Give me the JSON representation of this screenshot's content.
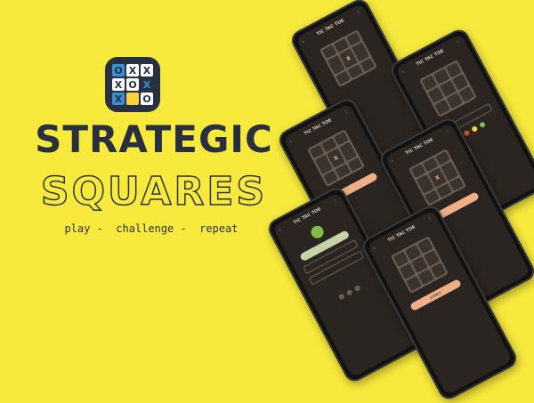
{
  "brand": {
    "title_line1": "STRATEGIC",
    "title_line2": "SQUARES",
    "tagline": "play -  challenge -  repeat",
    "colors": {
      "background": "#f8ea3c",
      "ink": "#283040",
      "tile": "#273142",
      "accent_blue": "#3a8fd1"
    }
  },
  "logo": {
    "cells": [
      "O",
      "X",
      "X",
      "X",
      "O",
      "X",
      "X",
      "",
      "O"
    ],
    "cell_styles": [
      "blue",
      "white",
      "white",
      "white",
      "white",
      "dark",
      "blue",
      "yellow",
      "white"
    ]
  },
  "phones": [
    {
      "title": "TIC TAC TOE",
      "line": "",
      "cells": [
        "",
        "",
        "",
        "",
        "X",
        "",
        "",
        "",
        ""
      ],
      "button": ""
    },
    {
      "title": "TIC TAC TOE",
      "line": "",
      "cells": [
        "",
        "",
        "",
        "",
        "",
        "",
        "",
        "",
        ""
      ],
      "button": ""
    },
    {
      "title": "TIC TAC TOE",
      "line": "",
      "cells": [
        "",
        "",
        "",
        "",
        "X",
        "",
        "",
        "",
        ""
      ],
      "button": ""
    },
    {
      "title": "TIC TAC TOE",
      "line": "",
      "cells": [
        "",
        "",
        "",
        "",
        "X",
        "",
        "",
        "",
        ""
      ],
      "button": ""
    },
    {
      "title": "TIC TAC TOE",
      "line": "",
      "cells": [
        "",
        "",
        "",
        "",
        "",
        "",
        "",
        "",
        ""
      ],
      "button": "JOINED"
    }
  ],
  "phone_left": {
    "title": "TIC TAC TOE"
  }
}
